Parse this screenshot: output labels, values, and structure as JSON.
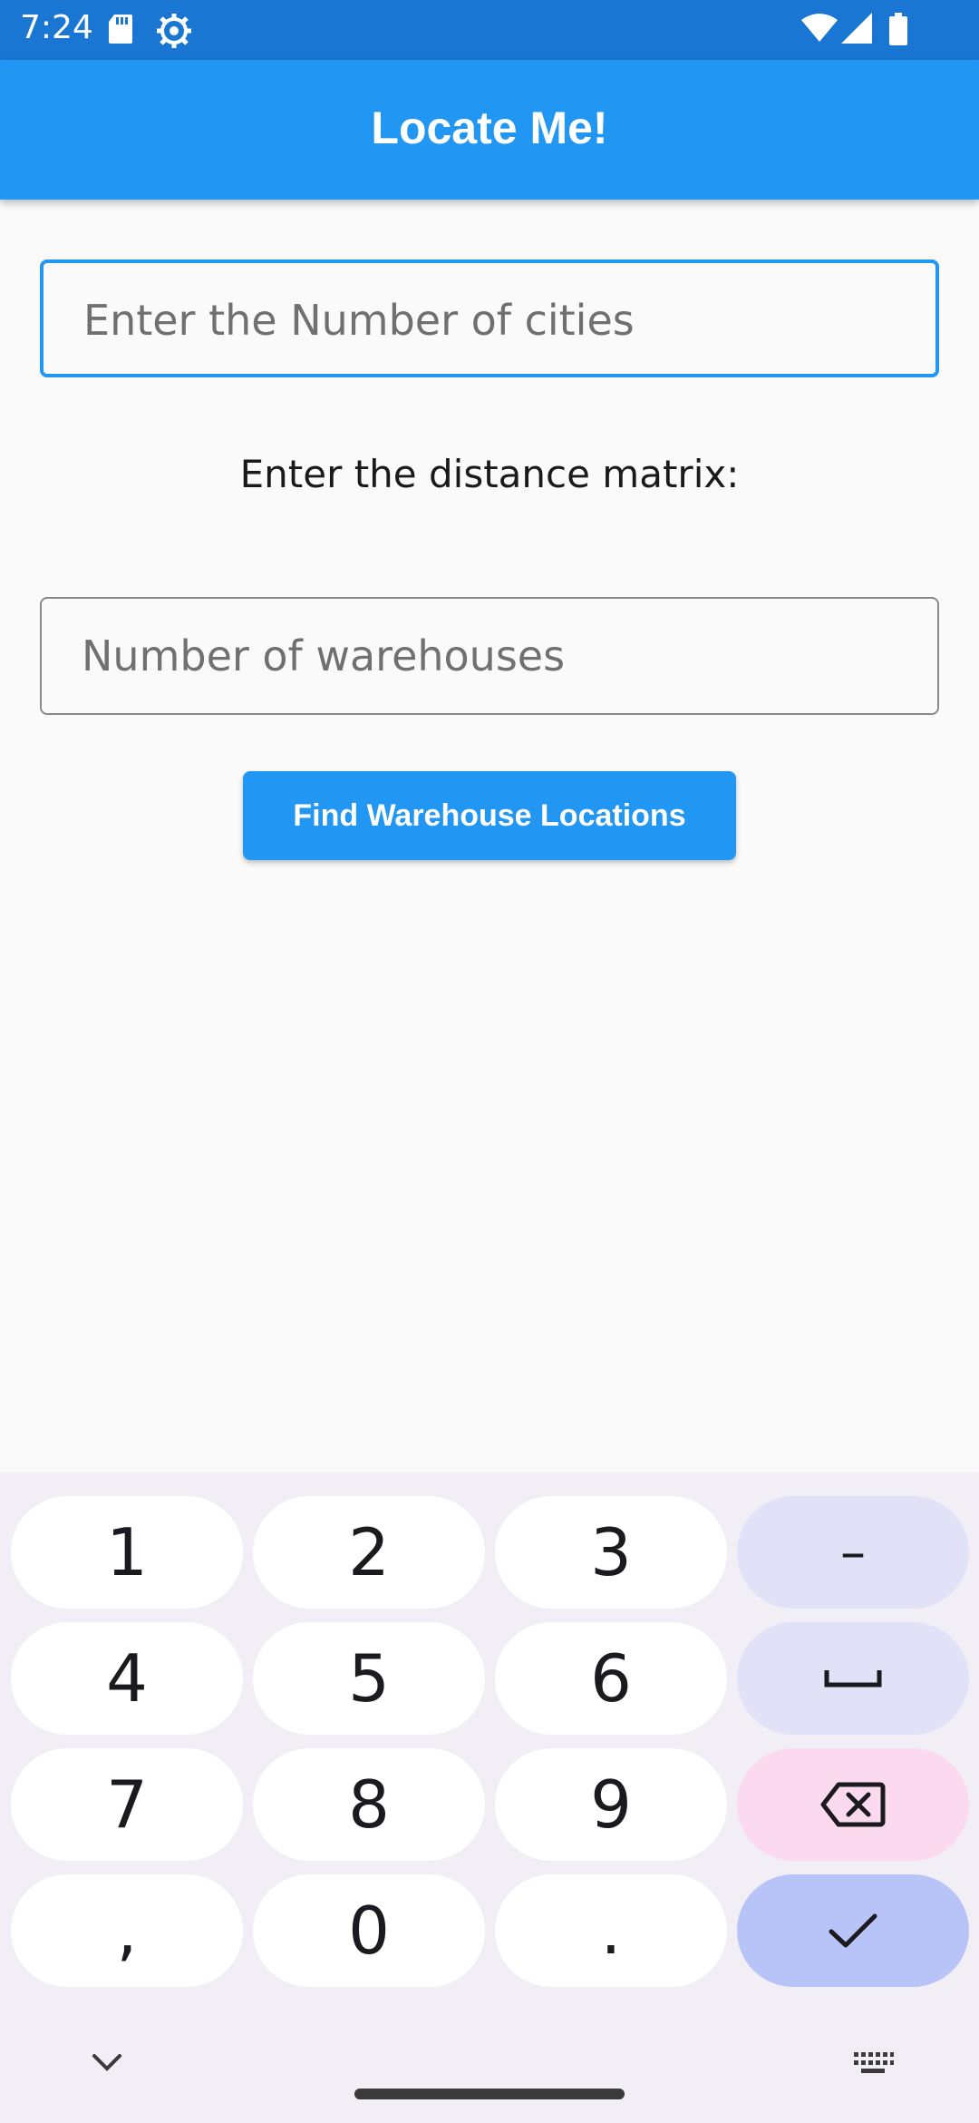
{
  "status_bar": {
    "time": "7:24",
    "icons_left": [
      "sd-card-icon",
      "settings-gear-icon"
    ],
    "icons_right": [
      "wifi-icon",
      "signal-icon",
      "battery-icon"
    ]
  },
  "app_bar": {
    "title": "Locate Me!"
  },
  "form": {
    "cities_placeholder": "Enter the Number of cities",
    "matrix_label": "Enter the distance matrix:",
    "warehouses_placeholder": "Number of warehouses",
    "find_button_label": "Find Warehouse Locations"
  },
  "keyboard": {
    "keys": {
      "k1": "1",
      "k2": "2",
      "k3": "3",
      "minus": "–",
      "k4": "4",
      "k5": "5",
      "k6": "6",
      "space": "␣",
      "k7": "7",
      "k8": "8",
      "k9": "9",
      "backspace": "backspace-icon",
      "comma": ",",
      "k0": "0",
      "period": ".",
      "enter": "check-icon"
    }
  },
  "colors": {
    "status_bar": "#1976d2",
    "app_bar": "#2196f3",
    "accent": "#2196f3",
    "background": "#fafafa",
    "keyboard_bg": "#f1eff5",
    "key_fn": "#e1e1f7",
    "key_delete": "#fbd9ee",
    "key_enter": "#b8c3f8"
  }
}
